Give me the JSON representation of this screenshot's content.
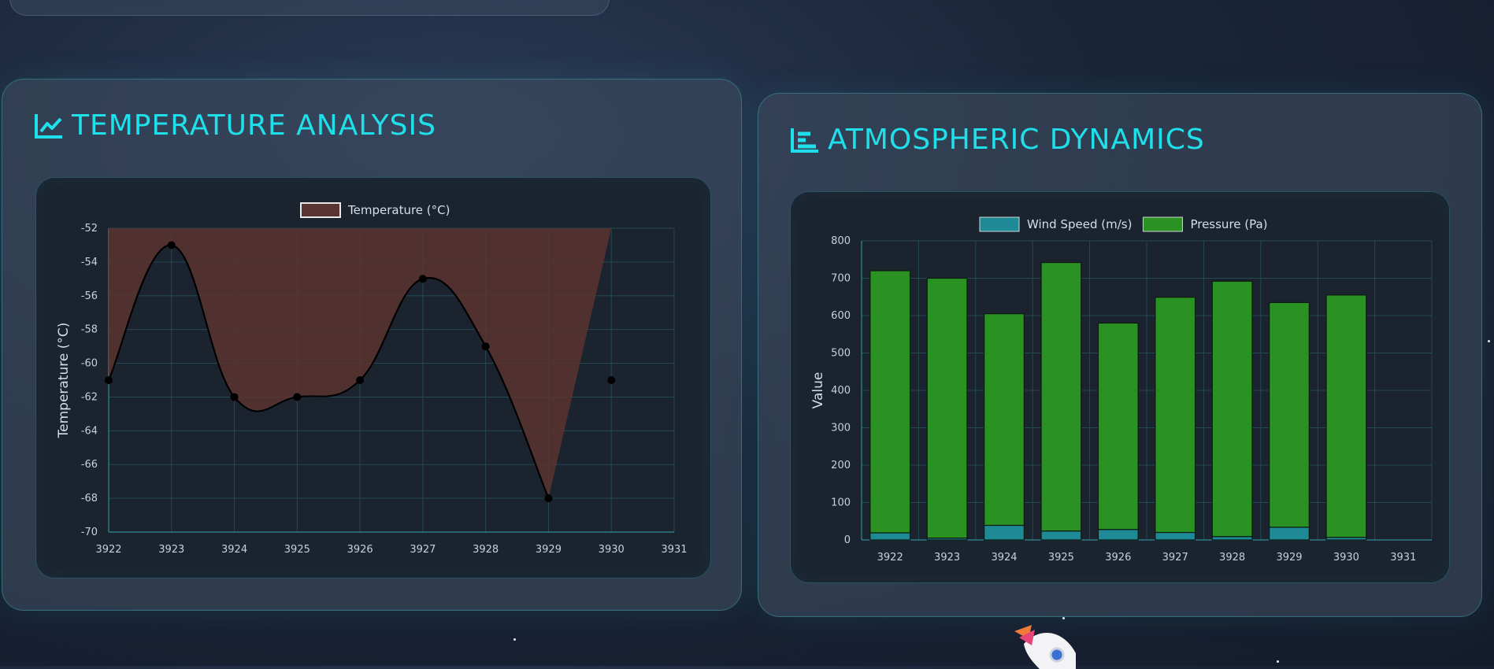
{
  "temperature_panel": {
    "title": "TEMPERATURE ANALYSIS",
    "icon": "line-chart-icon"
  },
  "atmospheric_panel": {
    "title": "ATMOSPHERIC DYNAMICS",
    "icon": "bar-chart-icon"
  },
  "chart_data": [
    {
      "type": "line",
      "title": "",
      "xlabel": "",
      "ylabel": "Temperature (°C)",
      "x": [
        3922,
        3923,
        3924,
        3925,
        3926,
        3927,
        3928,
        3929,
        3930,
        3931
      ],
      "xlim": [
        3922,
        3931
      ],
      "ylim": [
        -70,
        -52
      ],
      "yticks": [
        -52,
        -54,
        -56,
        -58,
        -60,
        -62,
        -64,
        -66,
        -68,
        -70
      ],
      "grid": true,
      "legend_position": "top",
      "series": [
        {
          "name": "Temperature (°C)",
          "x": [
            3922,
            3923,
            3924,
            3925,
            3926,
            3927,
            3928,
            3929,
            3930
          ],
          "values": [
            -61,
            -53,
            -62,
            -62,
            -61,
            -55,
            -59,
            -68,
            -61
          ],
          "line_color": "#000000",
          "fill_color": "#5a3430",
          "fill_to": "top"
        }
      ]
    },
    {
      "type": "bar",
      "title": "",
      "xlabel": "",
      "ylabel": "Value",
      "categories": [
        "3922",
        "3923",
        "3924",
        "3925",
        "3926",
        "3927",
        "3928",
        "3929",
        "3930",
        "3931"
      ],
      "ylim": [
        0,
        800
      ],
      "yticks": [
        0,
        100,
        200,
        300,
        400,
        500,
        600,
        700,
        800
      ],
      "grid": true,
      "legend_position": "top",
      "stacked": true,
      "series": [
        {
          "name": "Wind Speed (m/s)",
          "color": "#1d8a96",
          "values": [
            19,
            5,
            39,
            24,
            28,
            20,
            9,
            34,
            7,
            null
          ]
        },
        {
          "name": "Pressure (Pa)",
          "color": "#2a9222",
          "values": [
            701,
            695,
            566,
            718,
            552,
            629,
            683,
            601,
            648,
            null
          ]
        }
      ]
    }
  ]
}
